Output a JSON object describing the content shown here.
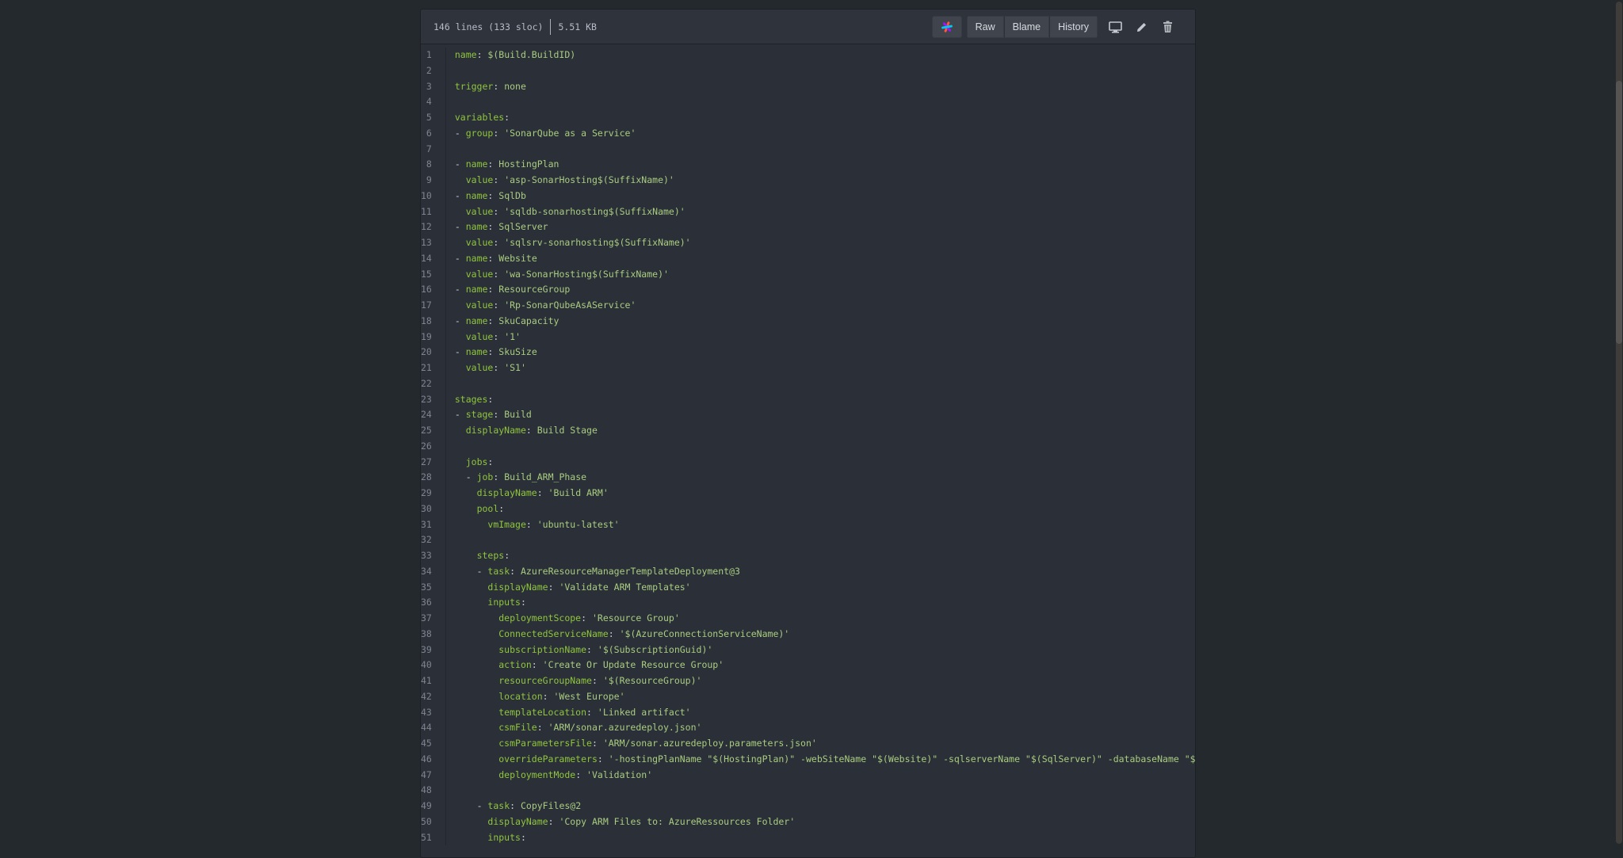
{
  "file_header": {
    "line_info": "146 lines (133 sloc)",
    "size": "5.51 KB",
    "buttons": {
      "raw": "Raw",
      "blame": "Blame",
      "history": "History"
    },
    "icons": [
      "sourcegraph-icon",
      "desktop-icon",
      "pencil-icon",
      "trash-icon"
    ]
  },
  "colors": {
    "background": "#24292e",
    "key": "#8fc63d",
    "value": "#a9cd80",
    "line_number": "#7e858f"
  },
  "code_lines": [
    {
      "n": "1",
      "indent": "",
      "dash": "",
      "key": "name",
      "value": "$(Build.BuildID)"
    },
    {
      "n": "2",
      "indent": "",
      "dash": "",
      "key": "",
      "value": ""
    },
    {
      "n": "3",
      "indent": "",
      "dash": "",
      "key": "trigger",
      "value": "none"
    },
    {
      "n": "4",
      "indent": "",
      "dash": "",
      "key": "",
      "value": ""
    },
    {
      "n": "5",
      "indent": "",
      "dash": "",
      "key": "variables",
      "value": ""
    },
    {
      "n": "6",
      "indent": "",
      "dash": "- ",
      "key": "group",
      "value": "'SonarQube as a Service'"
    },
    {
      "n": "7",
      "indent": "",
      "dash": "",
      "key": "",
      "value": ""
    },
    {
      "n": "8",
      "indent": "",
      "dash": "- ",
      "key": "name",
      "value": "HostingPlan"
    },
    {
      "n": "9",
      "indent": "  ",
      "dash": "",
      "key": "value",
      "value": "'asp-SonarHosting$(SuffixName)'"
    },
    {
      "n": "10",
      "indent": "",
      "dash": "- ",
      "key": "name",
      "value": "SqlDb"
    },
    {
      "n": "11",
      "indent": "  ",
      "dash": "",
      "key": "value",
      "value": "'sqldb-sonarhosting$(SuffixName)'"
    },
    {
      "n": "12",
      "indent": "",
      "dash": "- ",
      "key": "name",
      "value": "SqlServer"
    },
    {
      "n": "13",
      "indent": "  ",
      "dash": "",
      "key": "value",
      "value": "'sqlsrv-sonarhosting$(SuffixName)'"
    },
    {
      "n": "14",
      "indent": "",
      "dash": "- ",
      "key": "name",
      "value": "Website"
    },
    {
      "n": "15",
      "indent": "  ",
      "dash": "",
      "key": "value",
      "value": "'wa-SonarHosting$(SuffixName)'"
    },
    {
      "n": "16",
      "indent": "",
      "dash": "- ",
      "key": "name",
      "value": "ResourceGroup"
    },
    {
      "n": "17",
      "indent": "  ",
      "dash": "",
      "key": "value",
      "value": "'Rp-SonarQubeAsAService'"
    },
    {
      "n": "18",
      "indent": "",
      "dash": "- ",
      "key": "name",
      "value": "SkuCapacity"
    },
    {
      "n": "19",
      "indent": "  ",
      "dash": "",
      "key": "value",
      "value": "'1'"
    },
    {
      "n": "20",
      "indent": "",
      "dash": "- ",
      "key": "name",
      "value": "SkuSize"
    },
    {
      "n": "21",
      "indent": "  ",
      "dash": "",
      "key": "value",
      "value": "'S1'"
    },
    {
      "n": "22",
      "indent": "",
      "dash": "",
      "key": "",
      "value": ""
    },
    {
      "n": "23",
      "indent": "",
      "dash": "",
      "key": "stages",
      "value": ""
    },
    {
      "n": "24",
      "indent": "",
      "dash": "- ",
      "key": "stage",
      "value": "Build"
    },
    {
      "n": "25",
      "indent": "  ",
      "dash": "",
      "key": "displayName",
      "value": "Build Stage"
    },
    {
      "n": "26",
      "indent": "",
      "dash": "",
      "key": "",
      "value": ""
    },
    {
      "n": "27",
      "indent": "  ",
      "dash": "",
      "key": "jobs",
      "value": ""
    },
    {
      "n": "28",
      "indent": "  ",
      "dash": "- ",
      "key": "job",
      "value": "Build_ARM_Phase"
    },
    {
      "n": "29",
      "indent": "    ",
      "dash": "",
      "key": "displayName",
      "value": "'Build ARM'"
    },
    {
      "n": "30",
      "indent": "    ",
      "dash": "",
      "key": "pool",
      "value": ""
    },
    {
      "n": "31",
      "indent": "      ",
      "dash": "",
      "key": "vmImage",
      "value": "'ubuntu-latest'"
    },
    {
      "n": "32",
      "indent": "",
      "dash": "",
      "key": "",
      "value": ""
    },
    {
      "n": "33",
      "indent": "    ",
      "dash": "",
      "key": "steps",
      "value": ""
    },
    {
      "n": "34",
      "indent": "    ",
      "dash": "- ",
      "key": "task",
      "value": "AzureResourceManagerTemplateDeployment@3"
    },
    {
      "n": "35",
      "indent": "      ",
      "dash": "",
      "key": "displayName",
      "value": "'Validate ARM Templates'"
    },
    {
      "n": "36",
      "indent": "      ",
      "dash": "",
      "key": "inputs",
      "value": ""
    },
    {
      "n": "37",
      "indent": "        ",
      "dash": "",
      "key": "deploymentScope",
      "value": "'Resource Group'"
    },
    {
      "n": "38",
      "indent": "        ",
      "dash": "",
      "key": "ConnectedServiceName",
      "value": "'$(AzureConnectionServiceName)'"
    },
    {
      "n": "39",
      "indent": "        ",
      "dash": "",
      "key": "subscriptionName",
      "value": "'$(SubscriptionGuid)'"
    },
    {
      "n": "40",
      "indent": "        ",
      "dash": "",
      "key": "action",
      "value": "'Create Or Update Resource Group'"
    },
    {
      "n": "41",
      "indent": "        ",
      "dash": "",
      "key": "resourceGroupName",
      "value": "'$(ResourceGroup)'"
    },
    {
      "n": "42",
      "indent": "        ",
      "dash": "",
      "key": "location",
      "value": "'West Europe'"
    },
    {
      "n": "43",
      "indent": "        ",
      "dash": "",
      "key": "templateLocation",
      "value": "'Linked artifact'"
    },
    {
      "n": "44",
      "indent": "        ",
      "dash": "",
      "key": "csmFile",
      "value": "'ARM/sonar.azuredeploy.json'"
    },
    {
      "n": "45",
      "indent": "        ",
      "dash": "",
      "key": "csmParametersFile",
      "value": "'ARM/sonar.azuredeploy.parameters.json'"
    },
    {
      "n": "46",
      "indent": "        ",
      "dash": "",
      "key": "overrideParameters",
      "value": "'-hostingPlanName \"$(HostingPlan)\" -webSiteName \"$(Website)\" -sqlserverName \"$(SqlServer)\" -databaseName \"$(Sql"
    },
    {
      "n": "47",
      "indent": "        ",
      "dash": "",
      "key": "deploymentMode",
      "value": "'Validation'"
    },
    {
      "n": "48",
      "indent": "",
      "dash": "",
      "key": "",
      "value": ""
    },
    {
      "n": "49",
      "indent": "    ",
      "dash": "- ",
      "key": "task",
      "value": "CopyFiles@2"
    },
    {
      "n": "50",
      "indent": "      ",
      "dash": "",
      "key": "displayName",
      "value": "'Copy ARM Files to: AzureRessources Folder'"
    },
    {
      "n": "51",
      "indent": "      ",
      "dash": "",
      "key": "inputs",
      "value": ""
    }
  ]
}
